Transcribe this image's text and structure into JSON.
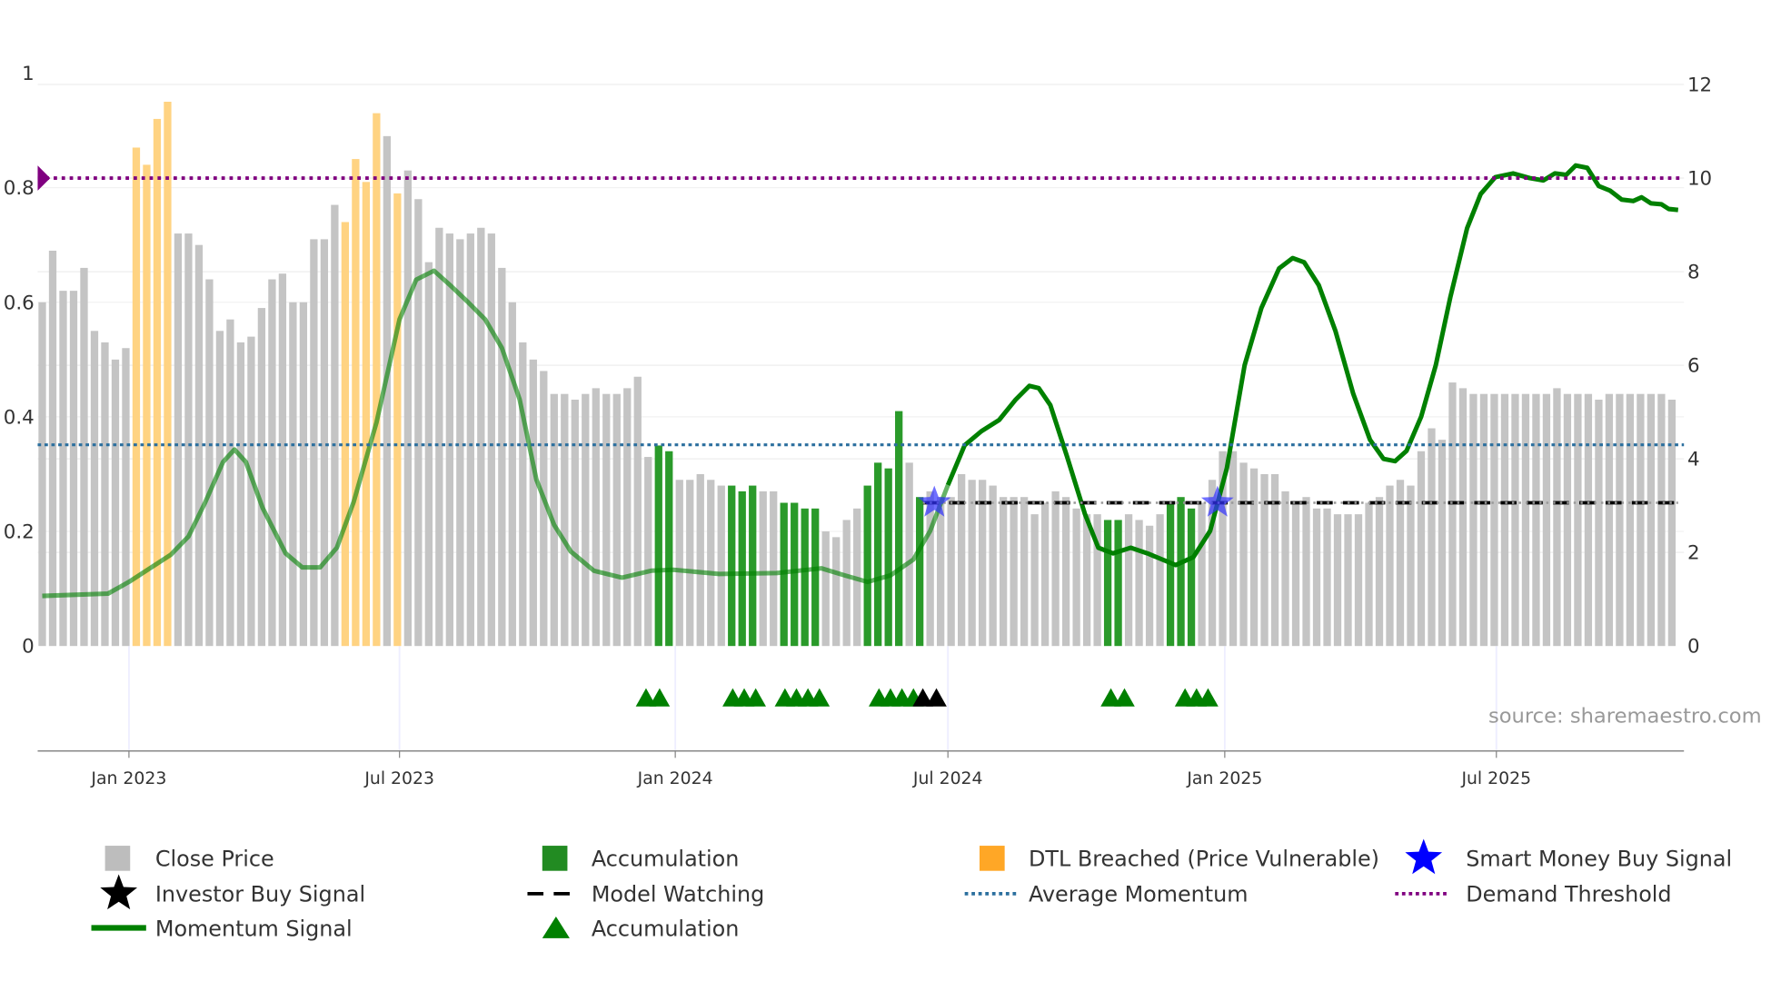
{
  "chart_data": {
    "type": "bar",
    "title": "",
    "x_unit": "week index",
    "left_axis": {
      "ticks": [
        "0",
        "0.2",
        "0.4",
        "0.6",
        "0.8",
        "1"
      ],
      "values": [
        0,
        0.2,
        0.4,
        0.6,
        0.8,
        1
      ],
      "range": [
        0,
        1
      ]
    },
    "right_axis": {
      "ticks": [
        "0",
        "2",
        "4",
        "6",
        "8",
        "10",
        "12"
      ],
      "values": [
        0,
        2,
        4,
        6,
        8,
        10,
        12
      ],
      "range": [
        0,
        12
      ]
    },
    "x_ticks": [
      {
        "label": "Jan 2023",
        "week": 8.3
      },
      {
        "label": "Jul 2023",
        "week": 34.2
      },
      {
        "label": "Jan 2024",
        "week": 60.6
      },
      {
        "label": "Jul 2024",
        "week": 86.7
      },
      {
        "label": "Jan 2025",
        "week": 113.2
      },
      {
        "label": "Jul 2025",
        "week": 139.2
      }
    ],
    "bars": {
      "values": [
        0.6,
        0.69,
        0.62,
        0.62,
        0.66,
        0.55,
        0.53,
        0.5,
        0.52,
        0.87,
        0.84,
        0.92,
        0.95,
        0.72,
        0.72,
        0.7,
        0.64,
        0.55,
        0.57,
        0.53,
        0.54,
        0.59,
        0.64,
        0.65,
        0.6,
        0.6,
        0.71,
        0.71,
        0.77,
        0.74,
        0.85,
        0.81,
        0.93,
        0.89,
        0.79,
        0.83,
        0.78,
        0.67,
        0.73,
        0.72,
        0.71,
        0.72,
        0.73,
        0.72,
        0.66,
        0.6,
        0.53,
        0.5,
        0.48,
        0.44,
        0.44,
        0.43,
        0.44,
        0.45,
        0.44,
        0.44,
        0.45,
        0.47,
        0.33,
        0.35,
        0.34,
        0.29,
        0.29,
        0.3,
        0.29,
        0.28,
        0.28,
        0.27,
        0.28,
        0.27,
        0.27,
        0.25,
        0.25,
        0.24,
        0.24,
        0.2,
        0.19,
        0.22,
        0.24,
        0.28,
        0.32,
        0.31,
        0.41,
        0.32,
        0.26,
        0.27,
        0.26,
        0.26,
        0.3,
        0.29,
        0.29,
        0.28,
        0.26,
        0.26,
        0.26,
        0.23,
        0.25,
        0.27,
        0.26,
        0.24,
        0.23,
        0.23,
        0.22,
        0.22,
        0.23,
        0.22,
        0.21,
        0.23,
        0.25,
        0.26,
        0.24,
        0.25,
        0.29,
        0.34,
        0.34,
        0.32,
        0.31,
        0.3,
        0.3,
        0.27,
        0.25,
        0.26,
        0.24,
        0.24,
        0.23,
        0.23,
        0.23,
        0.25,
        0.26,
        0.28,
        0.29,
        0.28,
        0.34,
        0.38,
        0.36,
        0.46,
        0.45,
        0.44,
        0.44,
        0.44,
        0.44,
        0.44,
        0.44,
        0.44,
        0.44,
        0.45,
        0.44,
        0.44,
        0.44,
        0.43,
        0.44,
        0.44,
        0.44,
        0.44,
        0.44,
        0.44,
        0.43
      ],
      "types": "gggggggggooooggggggggggggggggoooogoggggggggggggggggggggggggaagggggaaaggaaaaggggaaaagagggggggggggggggggaaggggaaaggggggggggggggggggggggggggggggggggggggggggggggggg"
    },
    "momentum": [
      [
        0,
        1.07
      ],
      [
        6.3,
        1.12
      ],
      [
        8.3,
        1.37
      ],
      [
        12.3,
        1.95
      ],
      [
        14,
        2.34
      ],
      [
        15.6,
        3.07
      ],
      [
        17.3,
        3.93
      ],
      [
        18.4,
        4.2
      ],
      [
        19.5,
        3.93
      ],
      [
        21.1,
        2.95
      ],
      [
        23.3,
        1.98
      ],
      [
        24.9,
        1.68
      ],
      [
        26.6,
        1.68
      ],
      [
        28.2,
        2.1
      ],
      [
        29.8,
        3.07
      ],
      [
        32,
        4.78
      ],
      [
        34.2,
        6.98
      ],
      [
        35.8,
        7.83
      ],
      [
        37.5,
        8.02
      ],
      [
        39.1,
        7.7
      ],
      [
        40.8,
        7.34
      ],
      [
        42.4,
        6.98
      ],
      [
        44,
        6.37
      ],
      [
        45.7,
        5.27
      ],
      [
        47.3,
        3.56
      ],
      [
        49,
        2.59
      ],
      [
        50.6,
        2.02
      ],
      [
        52.8,
        1.61
      ],
      [
        55.5,
        1.46
      ],
      [
        58.3,
        1.61
      ],
      [
        60.4,
        1.63
      ],
      [
        64.8,
        1.54
      ],
      [
        70.3,
        1.56
      ],
      [
        74.6,
        1.66
      ],
      [
        76.8,
        1.51
      ],
      [
        79,
        1.37
      ],
      [
        81.2,
        1.51
      ],
      [
        83.4,
        1.85
      ],
      [
        85,
        2.46
      ],
      [
        86.7,
        3.44
      ],
      [
        88.3,
        4.29
      ],
      [
        89.9,
        4.59
      ],
      [
        91.6,
        4.83
      ],
      [
        93.2,
        5.27
      ],
      [
        94.5,
        5.56
      ],
      [
        95.4,
        5.51
      ],
      [
        96.5,
        5.15
      ],
      [
        98.1,
        4.05
      ],
      [
        99.8,
        2.83
      ],
      [
        101.1,
        2.1
      ],
      [
        102.5,
        1.98
      ],
      [
        104.2,
        2.1
      ],
      [
        105.8,
        1.98
      ],
      [
        108.5,
        1.73
      ],
      [
        110.2,
        1.9
      ],
      [
        111.8,
        2.46
      ],
      [
        113.4,
        3.8
      ],
      [
        115.1,
        6.0
      ],
      [
        116.7,
        7.22
      ],
      [
        118.4,
        8.07
      ],
      [
        119.7,
        8.29
      ],
      [
        120.8,
        8.2
      ],
      [
        122.2,
        7.71
      ],
      [
        123.8,
        6.73
      ],
      [
        125.5,
        5.39
      ],
      [
        127.1,
        4.41
      ],
      [
        128.4,
        4.0
      ],
      [
        129.5,
        3.95
      ],
      [
        130.6,
        4.17
      ],
      [
        132,
        4.9
      ],
      [
        133.4,
        6.0
      ],
      [
        134.8,
        7.46
      ],
      [
        136.4,
        8.93
      ],
      [
        137.7,
        9.66
      ],
      [
        139.1,
        10.02
      ],
      [
        140.8,
        10.1
      ],
      [
        142.4,
        10.0
      ],
      [
        143.7,
        9.95
      ],
      [
        144.8,
        10.1
      ],
      [
        145.9,
        10.07
      ],
      [
        146.8,
        10.27
      ],
      [
        147.9,
        10.22
      ],
      [
        149,
        9.83
      ],
      [
        150.1,
        9.73
      ],
      [
        151.2,
        9.54
      ],
      [
        152.3,
        9.51
      ],
      [
        153.1,
        9.59
      ],
      [
        154,
        9.46
      ],
      [
        155,
        9.44
      ],
      [
        155.7,
        9.34
      ],
      [
        156.6,
        9.32
      ]
    ],
    "average_momentum": 4.3,
    "demand_threshold": 10.0,
    "model_watching": {
      "value": 0.25,
      "from_week": 84.3,
      "to_week": 156.6
    },
    "accumulation_markers": [
      57.8,
      59.1,
      66.1,
      67.2,
      68.3,
      71.1,
      72.2,
      73.3,
      74.4,
      80.1,
      81.2,
      82.3,
      83.4,
      102.3,
      103.6,
      109.4,
      110.5,
      111.6
    ],
    "investor_buy_markers": [
      84.3,
      85.6
    ],
    "smart_money_stars": [
      {
        "week": 85.4,
        "value": 0.25
      },
      {
        "week": 112.5,
        "value": 0.25
      }
    ],
    "source": "source: sharemaestro.com",
    "legend": [
      {
        "label": "Close Price",
        "kind": "square",
        "color": "#bdbdbd"
      },
      {
        "label": "Accumulation",
        "kind": "square",
        "color": "#228b22"
      },
      {
        "label": "DTL Breached (Price Vulnerable)",
        "kind": "square",
        "color": "#ffa726"
      },
      {
        "label": "Smart Money Buy Signal",
        "kind": "star",
        "color": "#0000ff"
      },
      {
        "label": "Investor Buy Signal",
        "kind": "star",
        "color": "#000000"
      },
      {
        "label": "Model Watching",
        "kind": "dash",
        "color": "#000000"
      },
      {
        "label": "Average Momentum",
        "kind": "dot",
        "color": "#2b6f9e"
      },
      {
        "label": "Demand Threshold",
        "kind": "dot",
        "color": "#800080"
      },
      {
        "label": "Momentum Signal",
        "kind": "line",
        "color": "#008000"
      },
      {
        "label": "Accumulation",
        "kind": "triangle",
        "color": "#008000"
      }
    ],
    "legend_placement": "bottom",
    "colors": {
      "gray": "#c4c4c4",
      "accum": "#2a9a2a",
      "dtl": "#ffd382",
      "momentum": "#008000",
      "avg": "#2b6f9e",
      "demand": "#800080"
    }
  }
}
